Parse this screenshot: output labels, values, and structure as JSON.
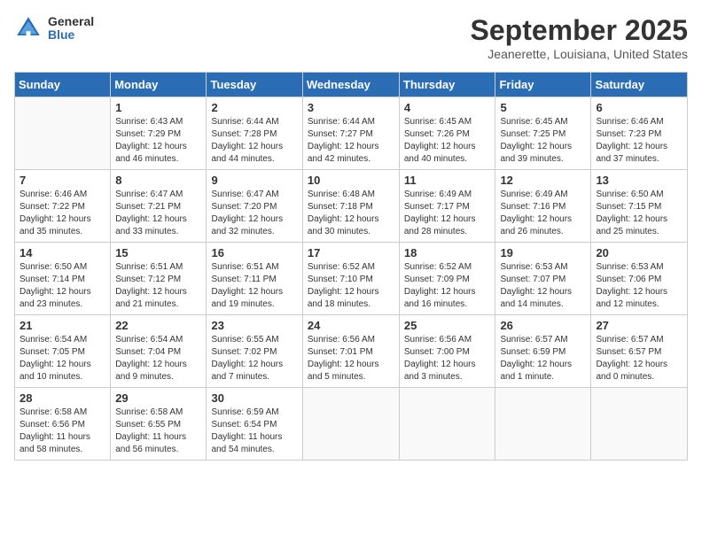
{
  "logo": {
    "general": "General",
    "blue": "Blue"
  },
  "title": "September 2025",
  "location": "Jeanerette, Louisiana, United States",
  "headers": [
    "Sunday",
    "Monday",
    "Tuesday",
    "Wednesday",
    "Thursday",
    "Friday",
    "Saturday"
  ],
  "weeks": [
    [
      {
        "day": "",
        "info": ""
      },
      {
        "day": "1",
        "info": "Sunrise: 6:43 AM\nSunset: 7:29 PM\nDaylight: 12 hours\nand 46 minutes."
      },
      {
        "day": "2",
        "info": "Sunrise: 6:44 AM\nSunset: 7:28 PM\nDaylight: 12 hours\nand 44 minutes."
      },
      {
        "day": "3",
        "info": "Sunrise: 6:44 AM\nSunset: 7:27 PM\nDaylight: 12 hours\nand 42 minutes."
      },
      {
        "day": "4",
        "info": "Sunrise: 6:45 AM\nSunset: 7:26 PM\nDaylight: 12 hours\nand 40 minutes."
      },
      {
        "day": "5",
        "info": "Sunrise: 6:45 AM\nSunset: 7:25 PM\nDaylight: 12 hours\nand 39 minutes."
      },
      {
        "day": "6",
        "info": "Sunrise: 6:46 AM\nSunset: 7:23 PM\nDaylight: 12 hours\nand 37 minutes."
      }
    ],
    [
      {
        "day": "7",
        "info": "Sunrise: 6:46 AM\nSunset: 7:22 PM\nDaylight: 12 hours\nand 35 minutes."
      },
      {
        "day": "8",
        "info": "Sunrise: 6:47 AM\nSunset: 7:21 PM\nDaylight: 12 hours\nand 33 minutes."
      },
      {
        "day": "9",
        "info": "Sunrise: 6:47 AM\nSunset: 7:20 PM\nDaylight: 12 hours\nand 32 minutes."
      },
      {
        "day": "10",
        "info": "Sunrise: 6:48 AM\nSunset: 7:18 PM\nDaylight: 12 hours\nand 30 minutes."
      },
      {
        "day": "11",
        "info": "Sunrise: 6:49 AM\nSunset: 7:17 PM\nDaylight: 12 hours\nand 28 minutes."
      },
      {
        "day": "12",
        "info": "Sunrise: 6:49 AM\nSunset: 7:16 PM\nDaylight: 12 hours\nand 26 minutes."
      },
      {
        "day": "13",
        "info": "Sunrise: 6:50 AM\nSunset: 7:15 PM\nDaylight: 12 hours\nand 25 minutes."
      }
    ],
    [
      {
        "day": "14",
        "info": "Sunrise: 6:50 AM\nSunset: 7:14 PM\nDaylight: 12 hours\nand 23 minutes."
      },
      {
        "day": "15",
        "info": "Sunrise: 6:51 AM\nSunset: 7:12 PM\nDaylight: 12 hours\nand 21 minutes."
      },
      {
        "day": "16",
        "info": "Sunrise: 6:51 AM\nSunset: 7:11 PM\nDaylight: 12 hours\nand 19 minutes."
      },
      {
        "day": "17",
        "info": "Sunrise: 6:52 AM\nSunset: 7:10 PM\nDaylight: 12 hours\nand 18 minutes."
      },
      {
        "day": "18",
        "info": "Sunrise: 6:52 AM\nSunset: 7:09 PM\nDaylight: 12 hours\nand 16 minutes."
      },
      {
        "day": "19",
        "info": "Sunrise: 6:53 AM\nSunset: 7:07 PM\nDaylight: 12 hours\nand 14 minutes."
      },
      {
        "day": "20",
        "info": "Sunrise: 6:53 AM\nSunset: 7:06 PM\nDaylight: 12 hours\nand 12 minutes."
      }
    ],
    [
      {
        "day": "21",
        "info": "Sunrise: 6:54 AM\nSunset: 7:05 PM\nDaylight: 12 hours\nand 10 minutes."
      },
      {
        "day": "22",
        "info": "Sunrise: 6:54 AM\nSunset: 7:04 PM\nDaylight: 12 hours\nand 9 minutes."
      },
      {
        "day": "23",
        "info": "Sunrise: 6:55 AM\nSunset: 7:02 PM\nDaylight: 12 hours\nand 7 minutes."
      },
      {
        "day": "24",
        "info": "Sunrise: 6:56 AM\nSunset: 7:01 PM\nDaylight: 12 hours\nand 5 minutes."
      },
      {
        "day": "25",
        "info": "Sunrise: 6:56 AM\nSunset: 7:00 PM\nDaylight: 12 hours\nand 3 minutes."
      },
      {
        "day": "26",
        "info": "Sunrise: 6:57 AM\nSunset: 6:59 PM\nDaylight: 12 hours\nand 1 minute."
      },
      {
        "day": "27",
        "info": "Sunrise: 6:57 AM\nSunset: 6:57 PM\nDaylight: 12 hours\nand 0 minutes."
      }
    ],
    [
      {
        "day": "28",
        "info": "Sunrise: 6:58 AM\nSunset: 6:56 PM\nDaylight: 11 hours\nand 58 minutes."
      },
      {
        "day": "29",
        "info": "Sunrise: 6:58 AM\nSunset: 6:55 PM\nDaylight: 11 hours\nand 56 minutes."
      },
      {
        "day": "30",
        "info": "Sunrise: 6:59 AM\nSunset: 6:54 PM\nDaylight: 11 hours\nand 54 minutes."
      },
      {
        "day": "",
        "info": ""
      },
      {
        "day": "",
        "info": ""
      },
      {
        "day": "",
        "info": ""
      },
      {
        "day": "",
        "info": ""
      }
    ]
  ]
}
